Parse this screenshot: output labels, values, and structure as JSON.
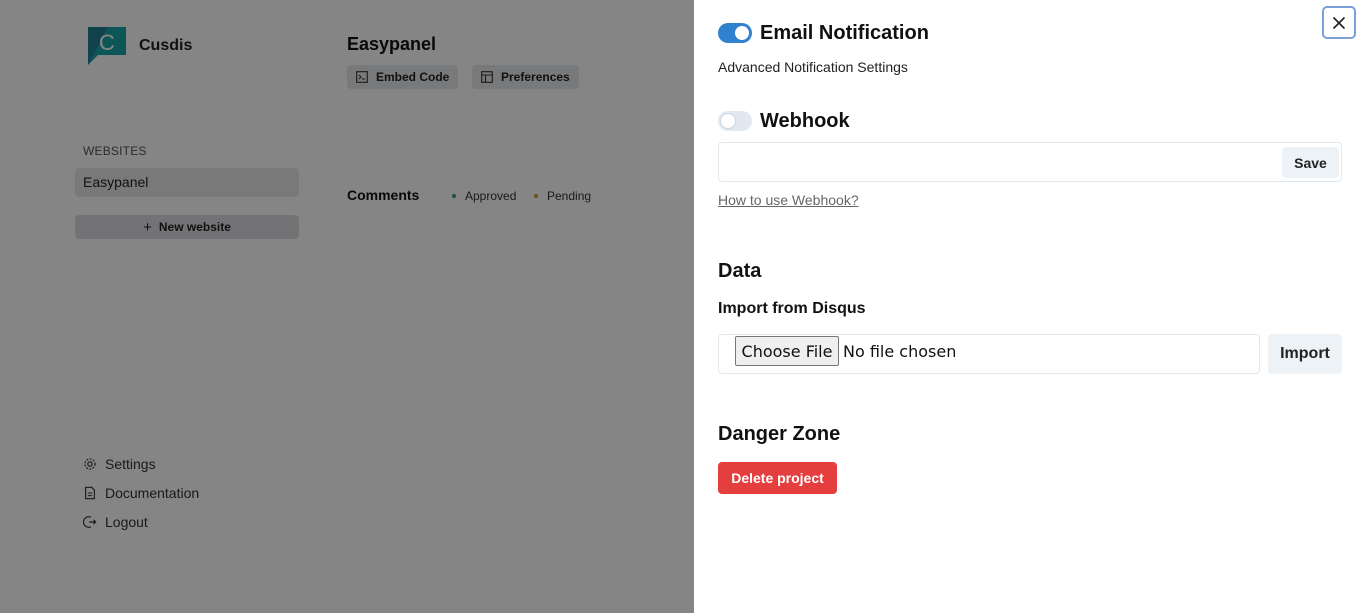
{
  "app": {
    "brand": "Cusdis",
    "sidebar": {
      "section_label": "WEBSITES",
      "websites": [
        "Easypanel"
      ],
      "new_website_label": "New website",
      "bottom_nav": [
        {
          "label": "Settings",
          "icon": "gear-icon"
        },
        {
          "label": "Documentation",
          "icon": "document-icon"
        },
        {
          "label": "Logout",
          "icon": "logout-icon"
        }
      ]
    },
    "main": {
      "project_title": "Easypanel",
      "tabs": [
        {
          "label": "Embed Code",
          "icon": "code-icon"
        },
        {
          "label": "Preferences",
          "icon": "layout-icon"
        }
      ],
      "comments_label": "Comments",
      "filters": [
        {
          "label": "Approved",
          "dot_color": "#38a169"
        },
        {
          "label": "Pending",
          "dot_color": "#d69e2e"
        }
      ]
    }
  },
  "drawer": {
    "email_notification": {
      "title": "Email Notification",
      "enabled": true,
      "subtext": "Advanced Notification Settings"
    },
    "webhook": {
      "title": "Webhook",
      "enabled": false,
      "input_value": "",
      "save_label": "Save",
      "help_link": "How to use Webhook?"
    },
    "data": {
      "title": "Data",
      "import_title": "Import from Disqus",
      "choose_file_label": "Choose File",
      "file_status": "No file chosen",
      "import_label": "Import"
    },
    "danger_zone": {
      "title": "Danger Zone",
      "delete_label": "Delete project"
    }
  },
  "colors": {
    "accent": "#3182ce",
    "danger": "#e53e3e",
    "brand_teal": "#1aa6a8",
    "brand_navy": "#2a3a6a"
  }
}
